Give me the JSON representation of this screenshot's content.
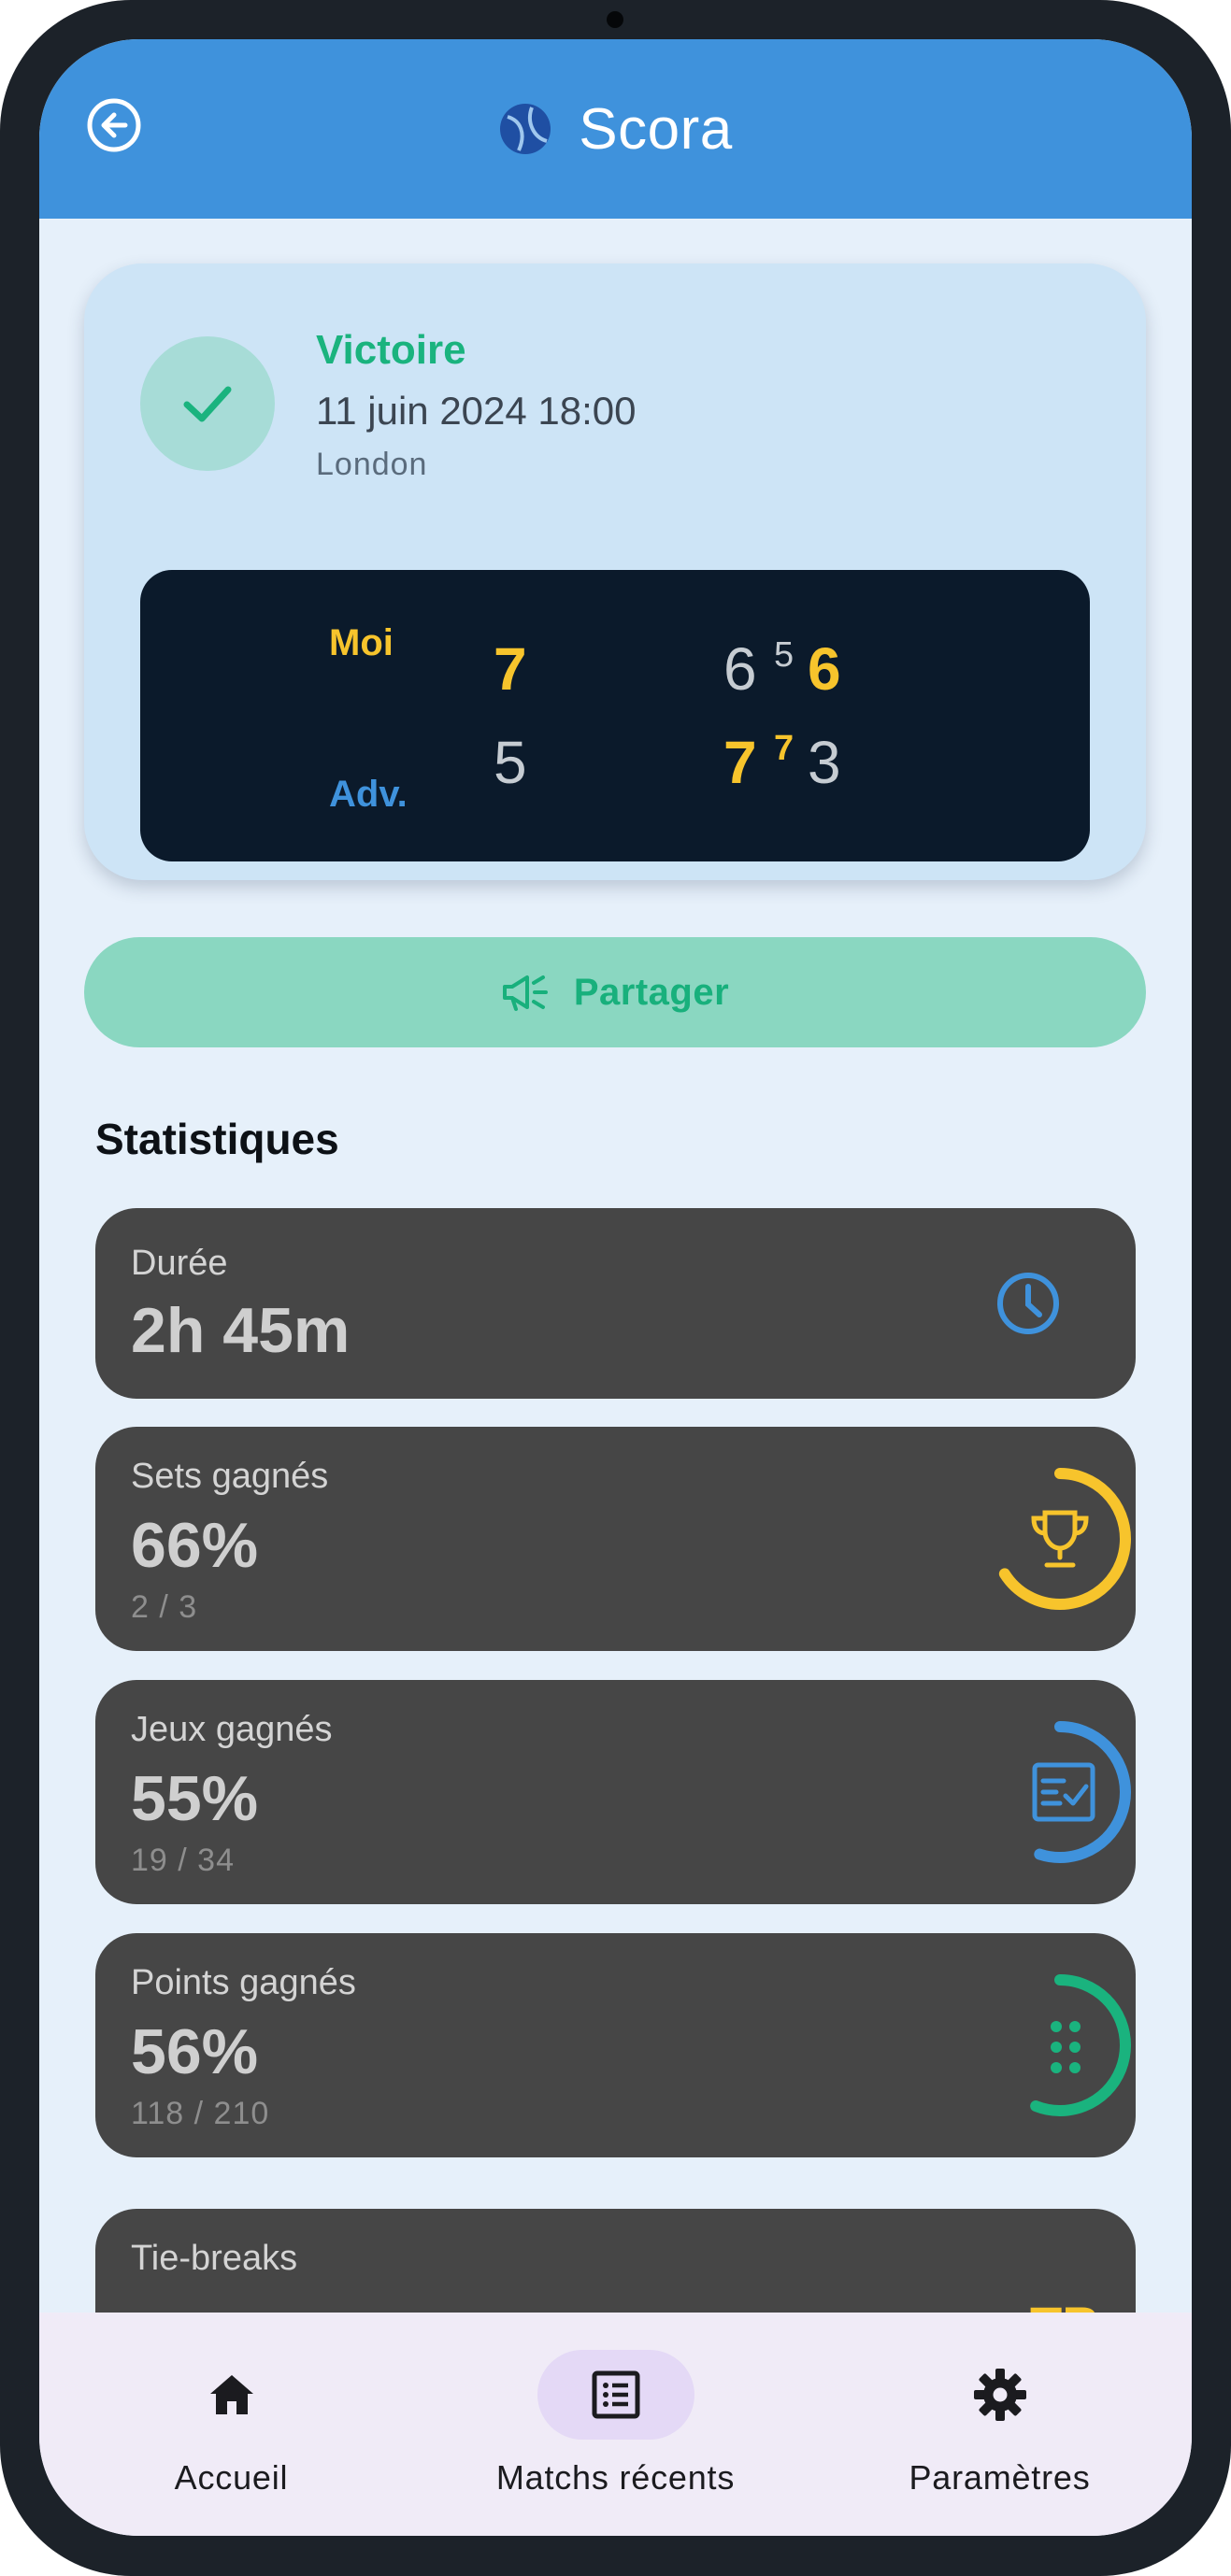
{
  "app": {
    "title": "Scora"
  },
  "match": {
    "result": "Victoire",
    "date": "11 juin 2024 18:00",
    "location": "London",
    "scoreboard": {
      "me_label": "Moi",
      "opponent_label": "Adv.",
      "sets": [
        {
          "me": "7",
          "opp": "5",
          "winner": "me"
        },
        {
          "me": "6",
          "opp": "7",
          "me_tiebreak": "5",
          "opp_tiebreak": "7",
          "winner": "opp"
        },
        {
          "me": "6",
          "opp": "3",
          "winner": "me"
        }
      ]
    }
  },
  "share": {
    "label": "Partager"
  },
  "stats": {
    "title": "Statistiques",
    "duration": {
      "label": "Durée",
      "value": "2h 45m"
    },
    "sets_won": {
      "label": "Sets gagnés",
      "value": "66%",
      "detail": "2 / 3",
      "progress": 0.66
    },
    "games_won": {
      "label": "Jeux gagnés",
      "value": "55%",
      "detail": "19 / 34",
      "progress": 0.55
    },
    "points_won": {
      "label": "Points gagnés",
      "value": "56%",
      "detail": "118 / 210",
      "progress": 0.56
    },
    "tiebreaks": {
      "label": "Tie-breaks",
      "icon_text": "TB"
    }
  },
  "nav": {
    "items": [
      {
        "label": "Accueil",
        "icon": "home-icon"
      },
      {
        "label": "Matchs récents",
        "icon": "list-icon",
        "active": true
      },
      {
        "label": "Paramètres",
        "icon": "gear-icon"
      }
    ]
  },
  "colors": {
    "appbar": "#3f92dc",
    "accent_green": "#1ab37e",
    "accent_yellow": "#f7c42c",
    "accent_blue": "#3f92dc",
    "card_dark": "#464646"
  }
}
